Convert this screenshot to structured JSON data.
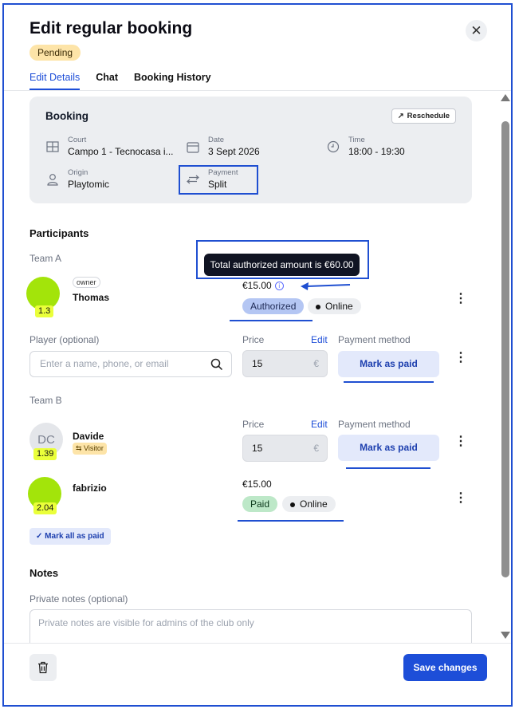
{
  "header": {
    "title": "Edit regular booking",
    "status_badge": "Pending",
    "tabs": [
      {
        "label": "Edit Details"
      },
      {
        "label": "Chat"
      },
      {
        "label": "Booking History"
      }
    ]
  },
  "booking": {
    "title": "Booking",
    "reschedule_label": "Reschedule",
    "fields": {
      "court": {
        "label": "Court",
        "value": "Campo 1 - Tecnocasa i..."
      },
      "date": {
        "label": "Date",
        "value": "3 Sept 2026"
      },
      "time": {
        "label": "Time",
        "value": "18:00 - 19:30"
      },
      "origin": {
        "label": "Origin",
        "value": "Playtomic"
      },
      "payment": {
        "label": "Payment",
        "value": "Split"
      }
    }
  },
  "participants": {
    "title": "Participants",
    "tooltip": "Total authorized amount is €60.00",
    "team_a": {
      "label": "Team A",
      "thomas": {
        "owner_tag": "owner",
        "name": "Thomas",
        "level": "1.3",
        "amount": "€15.00",
        "status": "Authorized",
        "payment": "Online"
      },
      "empty_slot": {
        "label": "Player (optional)",
        "placeholder": "Enter a name, phone, or email",
        "price_label": "Price",
        "edit_label": "Edit",
        "price": "15",
        "currency": "€",
        "method_label": "Payment method",
        "mark_paid_label": "Mark as paid"
      }
    },
    "team_b": {
      "label": "Team B",
      "davide": {
        "initials": "DC",
        "name": "Davide",
        "level": "1.39",
        "visitor_tag": "⇆ Visitor",
        "price_label": "Price",
        "edit_label": "Edit",
        "price": "15",
        "currency": "€",
        "method_label": "Payment method",
        "mark_paid_label": "Mark as paid"
      },
      "fabrizio": {
        "name": "fabrizio",
        "level": "2.04",
        "amount": "€15.00",
        "status": "Paid",
        "payment": "Online"
      }
    },
    "mark_all_label": "Mark all as paid"
  },
  "notes": {
    "title": "Notes",
    "label": "Private notes (optional)",
    "placeholder": "Private notes are visible for admins of the club only"
  },
  "footer": {
    "save_label": "Save changes"
  },
  "colors": {
    "accent": "#1d4ed8",
    "annotation": "#1f4fd1",
    "pending_bg": "#fde4a8",
    "authorized_bg": "#b4c6f3",
    "paid_bg": "#bde8c8",
    "avatar_lime": "#a3e40a",
    "level_bg": "#eaff3a"
  }
}
